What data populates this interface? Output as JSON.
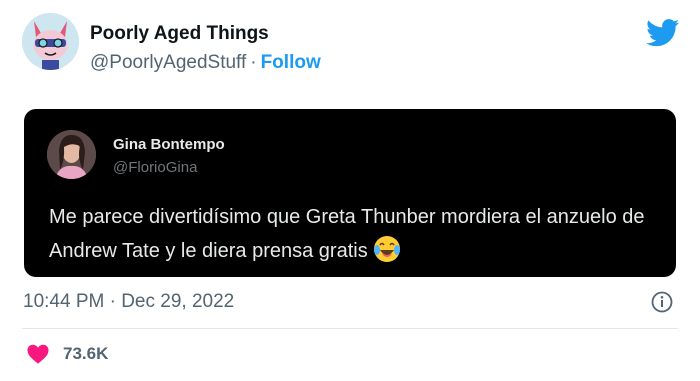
{
  "tweet": {
    "display_name": "Poorly Aged Things",
    "handle": "@PoorlyAgedStuff",
    "separator": "·",
    "follow_label": "Follow",
    "timestamp": "10:44 PM · Dec 29, 2022",
    "like_count": "73.6K"
  },
  "quoted_tweet": {
    "display_name": "Gina Bontempo",
    "handle": "@FlorioGina",
    "text": "Me parece divertidísimo que Greta Thunber mordiera el anzuelo de Andrew Tate y le diera prensa gratis"
  },
  "icons": {
    "brand": "twitter-bird-icon",
    "info": "info-icon",
    "like": "heart-icon",
    "emoji": "laughing-crying-emoji"
  },
  "colors": {
    "accent": "#1d9bf0",
    "like": "#f91880",
    "quote_background": "#000000",
    "secondary_text": "#536471"
  }
}
